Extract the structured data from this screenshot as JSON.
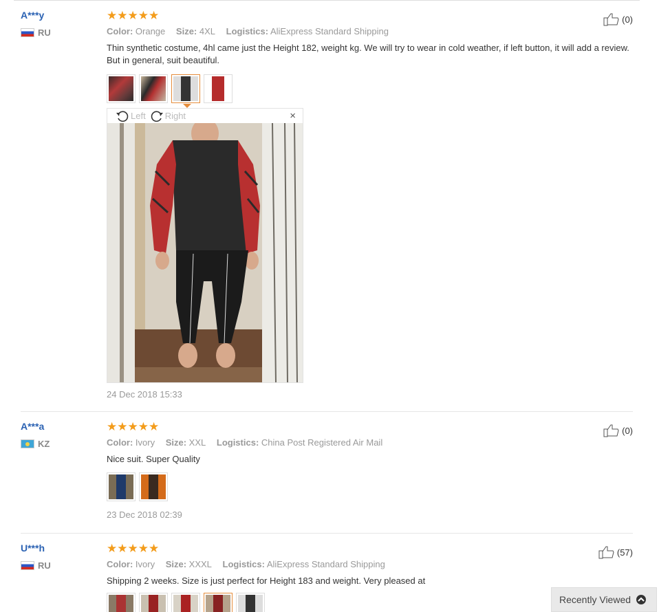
{
  "reviews": [
    {
      "user": "A***y",
      "country": "RU",
      "stars": "★★★★★",
      "color_label": "Color:",
      "color": "Orange",
      "size_label": "Size:",
      "size": "4XL",
      "logistics_label": "Logistics:",
      "logistics": "AliExpress Standard Shipping",
      "text": "Thin synthetic costume, 4hl came just the Height 182, weight kg. We will try to wear in cold weather, if left button, it will add a review. But in general, suit beautiful.",
      "likes": "(0)",
      "date": "24 Dec 2018 15:33"
    },
    {
      "user": "A***a",
      "country": "KZ",
      "stars": "★★★★★",
      "color_label": "Color:",
      "color": "Ivory",
      "size_label": "Size:",
      "size": "XXL",
      "logistics_label": "Logistics:",
      "logistics": "China Post Registered Air Mail",
      "text": "Nice suit. Super Quality",
      "likes": "(0)",
      "date": "23 Dec 2018 02:39"
    },
    {
      "user": "U***h",
      "country": "RU",
      "stars": "★★★★★",
      "color_label": "Color:",
      "color": "Ivory",
      "size_label": "Size:",
      "size": "XXXL",
      "logistics_label": "Logistics:",
      "logistics": "AliExpress Standard Shipping",
      "text": "Shipping 2 weeks. Size is just perfect for Height 183 and weight. Very pleased at",
      "likes": "(57)"
    }
  ],
  "viewer": {
    "rotate_left": "Left",
    "rotate_right": "Right",
    "close": "×"
  },
  "recently_viewed": "Recently Viewed",
  "icons": [
    "thumbs-up-icon",
    "rotate-left-icon",
    "rotate-right-icon",
    "close-icon",
    "chevron-up-icon",
    "flag-icon"
  ],
  "colors": {
    "accent": "#f39c1b",
    "link": "#2b62b3",
    "active_border": "#e58c3a"
  }
}
